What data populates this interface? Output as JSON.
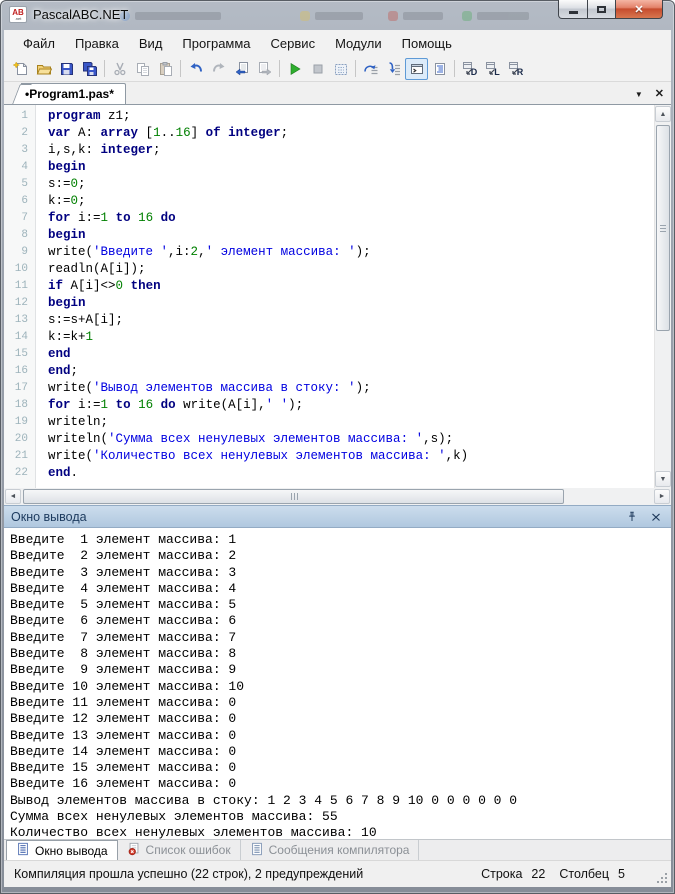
{
  "window": {
    "title": "PascalABC.NET",
    "logo_top": "AB",
    "logo_bottom": ".net"
  },
  "menu_bar": {
    "items": [
      {
        "id": "file",
        "label": "Файл"
      },
      {
        "id": "edit",
        "label": "Правка"
      },
      {
        "id": "view",
        "label": "Вид"
      },
      {
        "id": "program",
        "label": "Программа"
      },
      {
        "id": "service",
        "label": "Сервис"
      },
      {
        "id": "modules",
        "label": "Модули"
      },
      {
        "id": "help",
        "label": "Помощь"
      }
    ]
  },
  "toolbar": {
    "buttons": [
      {
        "name": "new-file"
      },
      {
        "name": "open-file"
      },
      {
        "name": "save-file"
      },
      {
        "name": "save-all"
      },
      {
        "name": "separator"
      },
      {
        "name": "cut",
        "disabled": true
      },
      {
        "name": "copy",
        "disabled": true
      },
      {
        "name": "paste",
        "disabled": true
      },
      {
        "name": "separator"
      },
      {
        "name": "undo"
      },
      {
        "name": "redo",
        "disabled": true
      },
      {
        "name": "nav-back"
      },
      {
        "name": "nav-forward",
        "disabled": true
      },
      {
        "name": "separator"
      },
      {
        "name": "run"
      },
      {
        "name": "stop",
        "disabled": true
      },
      {
        "name": "compile"
      },
      {
        "name": "separator"
      },
      {
        "name": "step-over"
      },
      {
        "name": "step-into"
      },
      {
        "name": "console-toggle",
        "active": true
      },
      {
        "name": "format-code"
      },
      {
        "name": "separator"
      },
      {
        "name": "window-letter",
        "letter": "D"
      },
      {
        "name": "window-letter",
        "letter": "L"
      },
      {
        "name": "window-letter",
        "letter": "R"
      }
    ]
  },
  "tab_strip": {
    "tabs": [
      {
        "label": "•Program1.pas*",
        "active": true
      }
    ]
  },
  "editor": {
    "syntax_colors": {
      "keyword": "#000080",
      "string": "#0000e0",
      "number": "#008000"
    },
    "lines": [
      {
        "n": 1,
        "s": [
          [
            "k",
            "program"
          ],
          [
            "p",
            " z1;"
          ]
        ]
      },
      {
        "n": 2,
        "s": [
          [
            "k",
            "var"
          ],
          [
            "p",
            " A: "
          ],
          [
            "k",
            "array"
          ],
          [
            "p",
            " ["
          ],
          [
            "n",
            "1"
          ],
          [
            "p",
            ".."
          ],
          [
            "n",
            "16"
          ],
          [
            "p",
            "] "
          ],
          [
            "k",
            "of"
          ],
          [
            "p",
            " "
          ],
          [
            "k",
            "integer"
          ],
          [
            "p",
            ";"
          ]
        ]
      },
      {
        "n": 3,
        "s": [
          [
            "p",
            "i,s,k: "
          ],
          [
            "k",
            "integer"
          ],
          [
            "p",
            ";"
          ]
        ]
      },
      {
        "n": 4,
        "s": [
          [
            "k",
            "begin"
          ]
        ]
      },
      {
        "n": 5,
        "s": [
          [
            "p",
            "s:="
          ],
          [
            "n",
            "0"
          ],
          [
            "p",
            ";"
          ]
        ]
      },
      {
        "n": 6,
        "s": [
          [
            "p",
            "k:="
          ],
          [
            "n",
            "0"
          ],
          [
            "p",
            ";"
          ]
        ]
      },
      {
        "n": 7,
        "s": [
          [
            "k",
            "for"
          ],
          [
            "p",
            " i:="
          ],
          [
            "n",
            "1"
          ],
          [
            "p",
            " "
          ],
          [
            "k",
            "to"
          ],
          [
            "p",
            " "
          ],
          [
            "n",
            "16"
          ],
          [
            "p",
            " "
          ],
          [
            "k",
            "do"
          ]
        ]
      },
      {
        "n": 8,
        "s": [
          [
            "k",
            "begin"
          ]
        ]
      },
      {
        "n": 9,
        "s": [
          [
            "p",
            "write("
          ],
          [
            "s",
            "'Введите '"
          ],
          [
            "p",
            ",i:"
          ],
          [
            "n",
            "2"
          ],
          [
            "p",
            ","
          ],
          [
            "s",
            "' элемент массива: '"
          ],
          [
            "p",
            ");"
          ]
        ]
      },
      {
        "n": 10,
        "s": [
          [
            "p",
            "readln(A[i]);"
          ]
        ]
      },
      {
        "n": 11,
        "s": [
          [
            "k",
            "if"
          ],
          [
            "p",
            " A[i]<>"
          ],
          [
            "n",
            "0"
          ],
          [
            "p",
            " "
          ],
          [
            "k",
            "then"
          ]
        ]
      },
      {
        "n": 12,
        "s": [
          [
            "k",
            "begin"
          ]
        ]
      },
      {
        "n": 13,
        "s": [
          [
            "p",
            "s:=s+A[i];"
          ]
        ]
      },
      {
        "n": 14,
        "s": [
          [
            "p",
            "k:=k+"
          ],
          [
            "n",
            "1"
          ]
        ]
      },
      {
        "n": 15,
        "s": [
          [
            "k",
            "end"
          ]
        ]
      },
      {
        "n": 16,
        "s": [
          [
            "k",
            "end"
          ],
          [
            "p",
            ";"
          ]
        ]
      },
      {
        "n": 17,
        "s": [
          [
            "p",
            "write("
          ],
          [
            "s",
            "'Вывод элементов массива в стоку: '"
          ],
          [
            "p",
            ");"
          ]
        ]
      },
      {
        "n": 18,
        "s": [
          [
            "k",
            "for"
          ],
          [
            "p",
            " i:="
          ],
          [
            "n",
            "1"
          ],
          [
            "p",
            " "
          ],
          [
            "k",
            "to"
          ],
          [
            "p",
            " "
          ],
          [
            "n",
            "16"
          ],
          [
            "p",
            " "
          ],
          [
            "k",
            "do"
          ],
          [
            "p",
            " write(A[i],"
          ],
          [
            "s",
            "' '"
          ],
          [
            "p",
            ");"
          ]
        ]
      },
      {
        "n": 19,
        "s": [
          [
            "p",
            "writeln;"
          ]
        ]
      },
      {
        "n": 20,
        "s": [
          [
            "p",
            "writeln("
          ],
          [
            "s",
            "'Сумма всех ненулевых элементов массива: '"
          ],
          [
            "p",
            ",s);"
          ]
        ]
      },
      {
        "n": 21,
        "s": [
          [
            "p",
            "write("
          ],
          [
            "s",
            "'Количество всех ненулевых элементов массива: '"
          ],
          [
            "p",
            ",k)"
          ]
        ]
      },
      {
        "n": 22,
        "s": [
          [
            "k",
            "end"
          ],
          [
            "p",
            "."
          ]
        ]
      }
    ]
  },
  "output_panel": {
    "title": "Окно вывода",
    "lines": [
      "Введите  1 элемент массива: 1",
      "Введите  2 элемент массива: 2",
      "Введите  3 элемент массива: 3",
      "Введите  4 элемент массива: 4",
      "Введите  5 элемент массива: 5",
      "Введите  6 элемент массива: 6",
      "Введите  7 элемент массива: 7",
      "Введите  8 элемент массива: 8",
      "Введите  9 элемент массива: 9",
      "Введите 10 элемент массива: 10",
      "Введите 11 элемент массива: 0",
      "Введите 12 элемент массива: 0",
      "Введите 13 элемент массива: 0",
      "Введите 14 элемент массива: 0",
      "Введите 15 элемент массива: 0",
      "Введите 16 элемент массива: 0",
      "Вывод элементов массива в стоку: 1 2 3 4 5 6 7 8 9 10 0 0 0 0 0 0",
      "Сумма всех ненулевых элементов массива: 55",
      "Количество всех ненулевых элементов массива: 10"
    ]
  },
  "bottom_tabs": {
    "tabs": [
      {
        "id": "output-window",
        "label": "Окно вывода",
        "icon": "output-doc",
        "active": true
      },
      {
        "id": "error-list",
        "label": "Список ошибок",
        "icon": "error-list",
        "disabled": true
      },
      {
        "id": "compiler-messages",
        "label": "Сообщения компилятора",
        "icon": "compiler-doc",
        "disabled": true
      }
    ]
  },
  "status_bar": {
    "message": "Компиляция прошла успешно (22 строк), 2 предупреждений",
    "line_label": "Строка",
    "line_value": "22",
    "column_label": "Столбец",
    "column_value": "5"
  }
}
